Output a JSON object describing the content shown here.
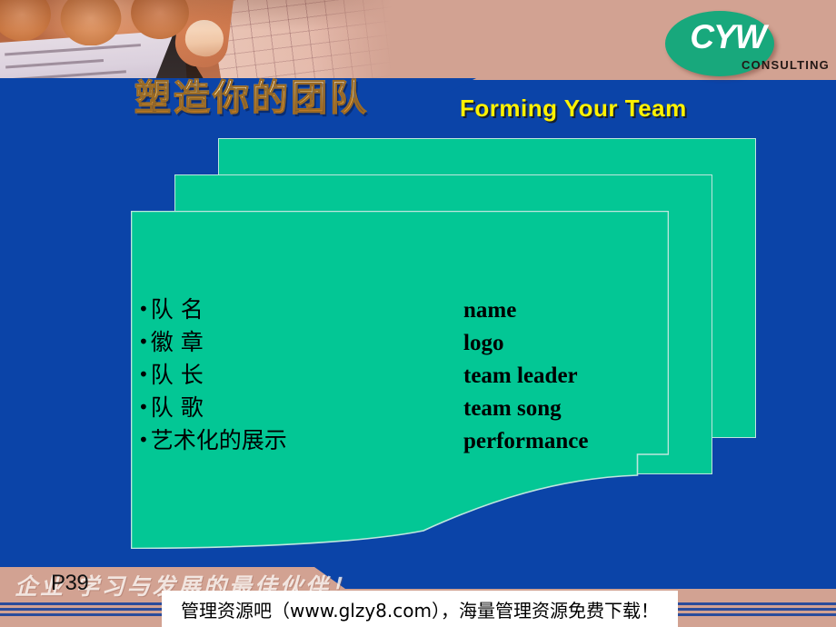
{
  "slide": {
    "title_cn": "塑造你的团队",
    "title_en": "Forming Your Team",
    "page_number": "P39"
  },
  "logo": {
    "mark": "CYW",
    "subtitle": "CONSULTING",
    "ellipse_color": "#18A87C",
    "mark_color": "#FFFFFF",
    "subtitle_color": "#231815"
  },
  "colors": {
    "background_blue": "#0B44A8",
    "card_green": "#03C795",
    "band_pink": "#D2A292",
    "title_en_yellow": "#FFF200",
    "stripe_blue": "#2B4C9B"
  },
  "content": {
    "items": [
      {
        "bullet": "•",
        "cn": "队 名",
        "en": "name"
      },
      {
        "bullet": "•",
        "cn": "徽 章",
        "en": "logo"
      },
      {
        "bullet": "•",
        "cn": "队 长",
        "en": "team leader"
      },
      {
        "bullet": "•",
        "cn": "队 歌",
        "en": "team song"
      },
      {
        "bullet": "•",
        "cn": "艺术化的展示",
        "en": "performance"
      }
    ]
  },
  "footer": {
    "watermark": "企业    学习与发展的最佳伙伴！",
    "banner_text": "管理资源吧（www.glzy8.com），海量管理资源免费下载！"
  }
}
